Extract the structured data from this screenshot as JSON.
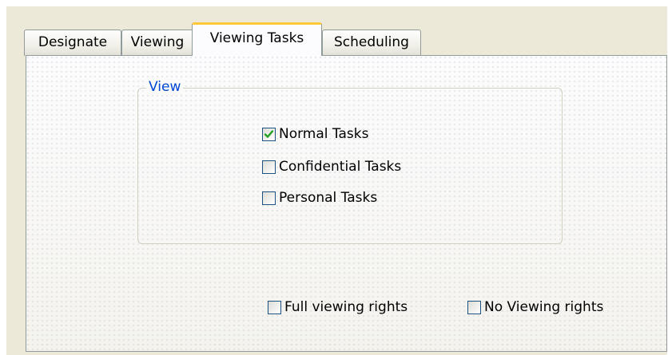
{
  "tabs": [
    {
      "label": "Designate",
      "active": false
    },
    {
      "label": "Viewing",
      "active": false
    },
    {
      "label": "Viewing Tasks",
      "active": true
    },
    {
      "label": "Scheduling",
      "active": false
    }
  ],
  "view_group": {
    "legend": "View",
    "options": [
      {
        "label": "Normal Tasks",
        "checked": true
      },
      {
        "label": "Confidential Tasks",
        "checked": false
      },
      {
        "label": "Personal Tasks",
        "checked": false
      }
    ]
  },
  "rights": {
    "full": {
      "label": "Full viewing rights",
      "checked": false
    },
    "none": {
      "label": "No Viewing rights",
      "checked": false
    }
  },
  "colors": {
    "accent_tab": "#ffc83c",
    "group_legend": "#0046d5",
    "checkmark": "#21a121",
    "checkbox_border": "#1c5180"
  },
  "icons": {
    "checked": "checkmark-icon"
  }
}
